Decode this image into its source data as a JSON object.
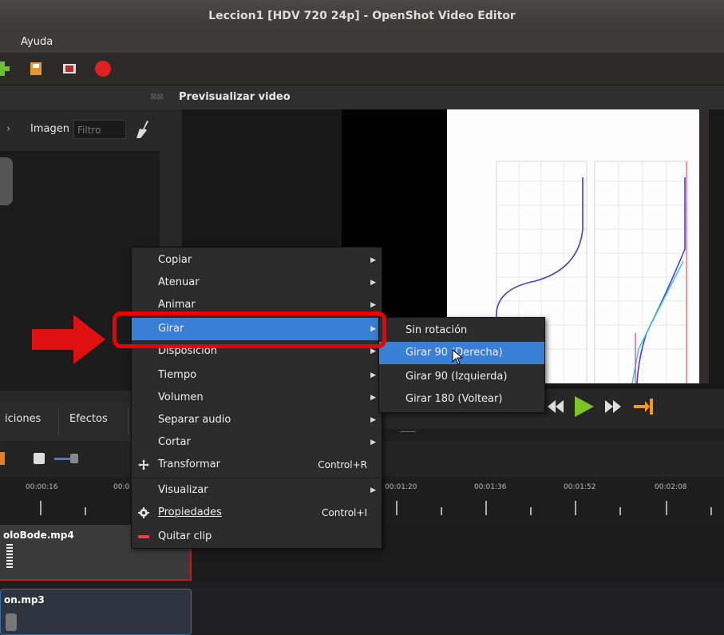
{
  "window": {
    "title": "Leccion1 [HDV 720 24p] - OpenShot Video Editor"
  },
  "menubar": {
    "help": "Ayuda"
  },
  "files_panel": {
    "filter_tab": "Imagen",
    "filter_placeholder": "Filtro"
  },
  "preview": {
    "title": "Previsualizar video"
  },
  "bottom_tabs": {
    "transitions": "iciones",
    "effects": "Efectos"
  },
  "ruler": {
    "labels": [
      "00:00:16",
      "00:0",
      "00:01:20",
      "00:01:36",
      "00:01:52",
      "00:02:08"
    ]
  },
  "tracks": {
    "clip1": "oloBode.mp4",
    "clip2": "on.mp3"
  },
  "context_menu": {
    "items": [
      {
        "label": "Copiar",
        "submenu": true
      },
      {
        "label": "Atenuar",
        "submenu": true
      },
      {
        "label": "Animar",
        "submenu": true
      },
      {
        "label": "Girar",
        "submenu": true,
        "highlighted": true
      },
      {
        "label": "Disposición",
        "submenu": true
      },
      {
        "label": "Tiempo",
        "submenu": true
      },
      {
        "label": "Volumen",
        "submenu": true
      },
      {
        "label": "Separar audio",
        "submenu": true
      },
      {
        "label": "Cortar",
        "submenu": true
      },
      {
        "label": "Transformar",
        "shortcut": "Control+R",
        "icon": "move-icon"
      },
      {
        "label": "Visualizar",
        "submenu": true
      },
      {
        "label": "Propiedades",
        "shortcut": "Control+I",
        "icon": "gear-icon"
      },
      {
        "label": "Quitar clip",
        "icon": "remove-icon"
      }
    ]
  },
  "rotate_submenu": {
    "items": [
      {
        "label": "Sin rotación"
      },
      {
        "label": "Girar 90 (Derecha)",
        "highlighted": true
      },
      {
        "label": "Girar 90 (Izquierda)"
      },
      {
        "label": "Girar 180 (Voltear)"
      }
    ]
  },
  "colors": {
    "highlight": "#3a7fd6",
    "annotation": "#e00000",
    "play": "#7cc520",
    "accent": "#f39c12"
  }
}
